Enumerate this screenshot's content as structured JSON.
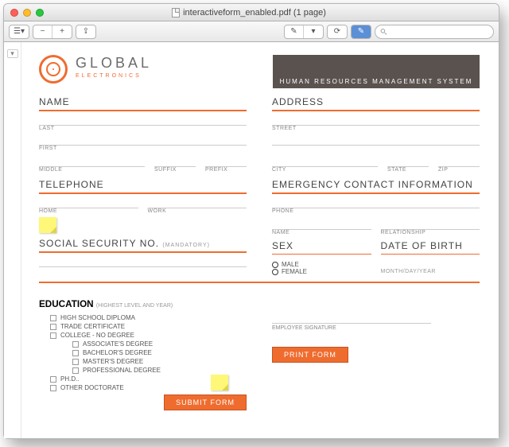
{
  "window": {
    "title": "interactiveform_enabled.pdf (1 page)"
  },
  "search": {
    "placeholder": ""
  },
  "brand": {
    "name": "GLOBAL",
    "sub": "ELECTRONICS"
  },
  "hrbox": "HUMAN RESOURCES MANAGEMENT SYSTEM",
  "left": {
    "name": {
      "title": "NAME",
      "last": "LAST",
      "first": "FIRST",
      "middle": "MIDDLE",
      "suffix": "SUFFIX",
      "prefix": "PREFIX"
    },
    "tel": {
      "title": "TELEPHONE",
      "home": "HOME",
      "work": "WORK"
    },
    "ssn": {
      "title": "SOCIAL SECURITY NO.",
      "mand": "(MANDATORY)"
    }
  },
  "right": {
    "addr": {
      "title": "ADDRESS",
      "street": "STREET",
      "city": "CITY",
      "state": "STATE",
      "zip": "ZIP"
    },
    "ec": {
      "title": "EMERGENCY CONTACT INFORMATION",
      "phone": "PHONE",
      "name": "NAME",
      "rel": "RELATIONSHIP"
    },
    "sex": {
      "title": "SEX",
      "male": "MALE",
      "female": "FEMALE"
    },
    "dob": {
      "title": "DATE OF BIRTH",
      "hint": "MONTH/DAY/YEAR"
    },
    "sig": "EMPLOYEE SIGNATURE"
  },
  "edu": {
    "title": "EDUCATION",
    "sub": "(HIGHEST LEVEL AND YEAR)",
    "items": {
      "hs": "HIGH SCHOOL DIPLOMA",
      "tc": "TRADE CERTIFICATE",
      "nc": "COLLEGE - NO DEGREE",
      "aa": "ASSOCIATE'S DEGREE",
      "ba": "BACHELOR'S DEGREE",
      "ma": "MASTER'S DEGREE",
      "pro": "PROFESSIONAL DEGREE",
      "phd": "PH.D..",
      "od": "OTHER DOCTORATE"
    }
  },
  "buttons": {
    "submit": "SUBMIT FORM",
    "print": "PRINT FORM"
  }
}
